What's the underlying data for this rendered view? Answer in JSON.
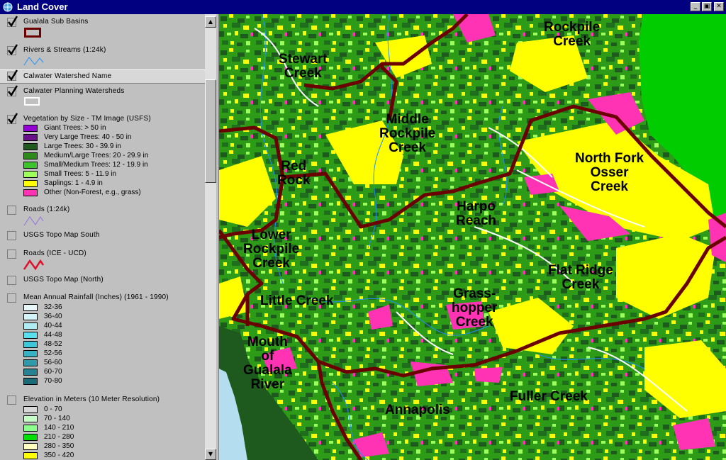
{
  "window": {
    "title": "Land Cover",
    "icon": "globe-icon"
  },
  "legend": {
    "layers": [
      {
        "name": "Gualala Sub Basins",
        "checked": true
      },
      {
        "name": "Rivers & Streams (1:24k)",
        "checked": true
      },
      {
        "name": "Calwater Watershed Name",
        "checked": true
      },
      {
        "name": "Calwater Planning Watersheds",
        "checked": true
      },
      {
        "name": "Vegetation by Size - TM Image (USFS)",
        "checked": true
      },
      {
        "name": "Roads (1:24k)",
        "checked": false
      },
      {
        "name": "USGS Topo Map South",
        "checked": false
      },
      {
        "name": "Roads (ICE - UCD)",
        "checked": false
      },
      {
        "name": "USGS Topo Map (North)",
        "checked": false
      },
      {
        "name": "Mean Annual Rainfall (Inches) (1961 - 1990)",
        "checked": false
      },
      {
        "name": "Elevation in Meters (10 Meter Resolution)",
        "checked": false
      }
    ],
    "vegetation_classes": [
      {
        "label": "Giant Trees: > 50 in",
        "color": "#9400d3"
      },
      {
        "label": "Very Large Trees: 40 - 50 in",
        "color": "#6a0f8a"
      },
      {
        "label": "Large Trees: 30 - 39.9 in",
        "color": "#1e5a1e"
      },
      {
        "label": "Medium/Large Trees: 20 - 29.9 in",
        "color": "#2f8a1c"
      },
      {
        "label": "Small/Medium Trees: 12 - 19.9 in",
        "color": "#3cc42a"
      },
      {
        "label": "Small Trees: 5 - 11.9 in",
        "color": "#9cff5c"
      },
      {
        "label": "Saplings: 1 - 4.9 in",
        "color": "#ffff00"
      },
      {
        "label": "Other (Non-Forest, e.g., grass)",
        "color": "#ff33b4"
      }
    ],
    "rainfall_classes": [
      {
        "label": "32-36",
        "color": "#e8f8fa"
      },
      {
        "label": "36-40",
        "color": "#d2f3f7"
      },
      {
        "label": "40-44",
        "color": "#b0edf3"
      },
      {
        "label": "44-48",
        "color": "#59e0ee"
      },
      {
        "label": "48-52",
        "color": "#3cc8d8"
      },
      {
        "label": "52-56",
        "color": "#38b2c2"
      },
      {
        "label": "56-60",
        "color": "#2f9aaa"
      },
      {
        "label": "60-70",
        "color": "#248292"
      },
      {
        "label": "70-80",
        "color": "#1a6a78"
      }
    ],
    "elevation_classes": [
      {
        "label": "0 - 70",
        "color": "#d8d8d8"
      },
      {
        "label": "70 - 140",
        "color": "#c6ffc6"
      },
      {
        "label": "140 - 210",
        "color": "#8cff8c"
      },
      {
        "label": "210 - 280",
        "color": "#00e000"
      },
      {
        "label": "280 - 350",
        "color": "#ffffc0"
      },
      {
        "label": "350 - 420",
        "color": "#ffff00"
      }
    ]
  },
  "map": {
    "labels": [
      "Rockpile\nCreek",
      "Stewart\nCreek",
      "Middle\nRockpile\nCreek",
      "North Fork\nOsser\nCreek",
      "Red\nRock",
      "Harpo\nReach",
      "Lower\nRockpile\nCreek",
      "Flat Ridge\nCreek",
      "Little Creek",
      "Grass-\nhopper\nCreek",
      "Mouth\nof\nGualala\nRiver",
      "Fuller Creek",
      "Annapolis"
    ]
  },
  "colors": {
    "title_bar": "#000080",
    "basin_boundary": "#6b0000",
    "streams": "#1e90ff",
    "roads": "#ffffff",
    "ocean": "#b4def0",
    "open_land": "#00cc00"
  }
}
